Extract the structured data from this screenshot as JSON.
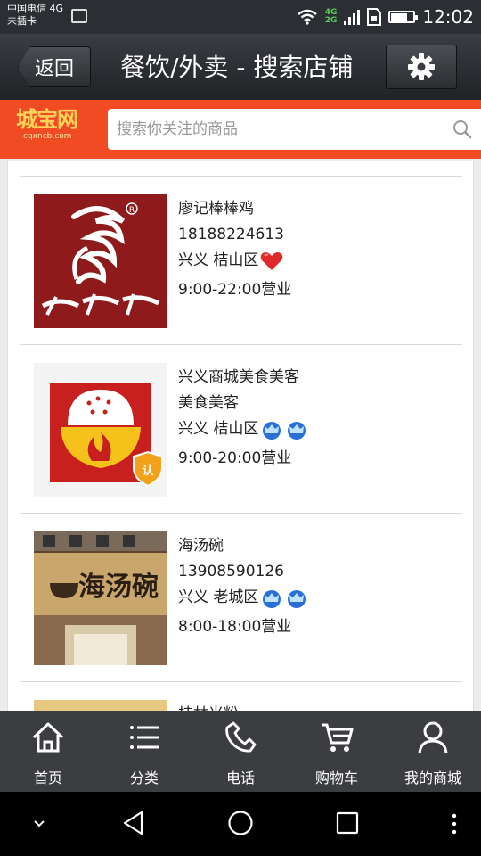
{
  "status_bar": {
    "carrier": "中国电信 4G",
    "sim": "未插卡",
    "network_label_top": "4G",
    "network_label_bottom": "2G",
    "time": "12:02"
  },
  "header": {
    "back_label": "返回",
    "title": "餐饮/外卖 - 搜索店铺"
  },
  "search": {
    "logo_main": "城宝网",
    "logo_domain": "cqxncb.com",
    "placeholder": "搜索你关注的商品"
  },
  "shops": [
    {
      "name": "廖记棒棒鸡",
      "subtitle": "18188224613",
      "location": "兴义 桔山区",
      "badge": "heart",
      "hours": "9:00-22:00营业"
    },
    {
      "name": "兴义商城美食美客",
      "subtitle": "美食美客",
      "location": "兴义 桔山区",
      "badge": "crown",
      "hours": "9:00-20:00营业"
    },
    {
      "name": "海汤碗",
      "subtitle": "13908590126",
      "location": "兴义 老城区",
      "badge": "crown",
      "hours": "8:00-18:00营业"
    },
    {
      "name": "桂林米粉",
      "subtitle": "",
      "location": "",
      "badge": "",
      "hours": ""
    }
  ],
  "bottom_nav": {
    "items": [
      {
        "label": "首页",
        "icon": "home-icon"
      },
      {
        "label": "分类",
        "icon": "list-icon"
      },
      {
        "label": "电话",
        "icon": "phone-icon"
      },
      {
        "label": "购物车",
        "icon": "cart-icon"
      },
      {
        "label": "我的商城",
        "icon": "user-icon"
      }
    ]
  },
  "colors": {
    "accent": "#f04b23",
    "titlebar": "#2b2d31",
    "navbar": "#3b3d41"
  }
}
